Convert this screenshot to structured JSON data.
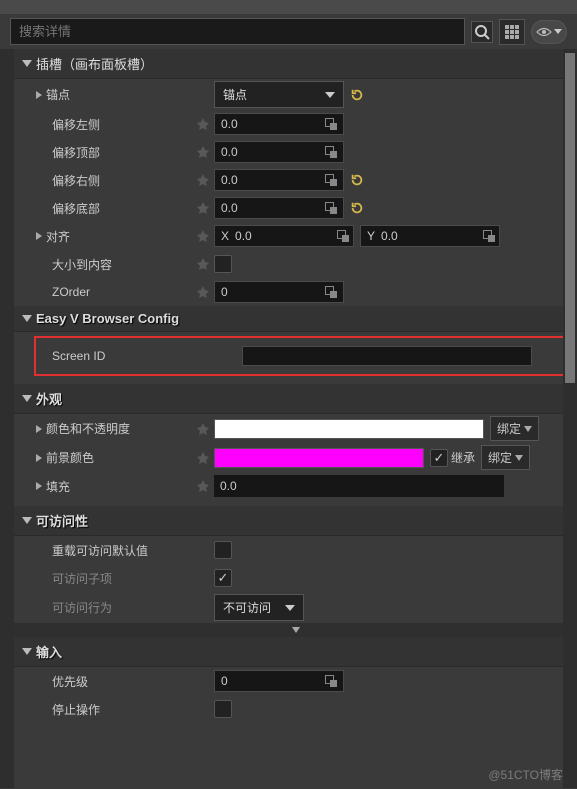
{
  "search": {
    "placeholder": "搜索详情"
  },
  "sections": {
    "slot": {
      "title": "插槽（画布面板槽）"
    },
    "easyv": {
      "title": "Easy V Browser Config"
    },
    "appearance": {
      "title": "外观"
    },
    "accessibility": {
      "title": "可访问性"
    },
    "input": {
      "title": "输入"
    }
  },
  "slot": {
    "anchor_label": "锚点",
    "anchor_value": "锚点",
    "offset_left_label": "偏移左侧",
    "offset_left": "0.0",
    "offset_top_label": "偏移顶部",
    "offset_top": "0.0",
    "offset_right_label": "偏移右侧",
    "offset_right": "0.0",
    "offset_bottom_label": "偏移底部",
    "offset_bottom": "0.0",
    "align_label": "对齐",
    "align_x_lbl": "X",
    "align_x": "0.0",
    "align_y_lbl": "Y",
    "align_y": "0.0",
    "size_to_content_label": "大小到内容",
    "zorder_label": "ZOrder",
    "zorder": "0"
  },
  "easyv": {
    "screen_id_label": "Screen ID",
    "screen_id": ""
  },
  "appearance": {
    "color_label": "颜色和不透明度",
    "color": "#ffffff",
    "fgcolor_label": "前景颜色",
    "fgcolor": "#ff00ff",
    "inherit_label": "继承",
    "bind_label": "绑定",
    "padding_label": "填充",
    "padding": "0.0"
  },
  "accessibility": {
    "override_label": "重载可访问默认值",
    "children_label": "可访问子项",
    "behavior_label": "可访问行为",
    "behavior_value": "不可访问"
  },
  "input": {
    "priority_label": "优先级",
    "priority": "0",
    "stop_label": "停止操作"
  },
  "watermark": "@51CTO博客"
}
